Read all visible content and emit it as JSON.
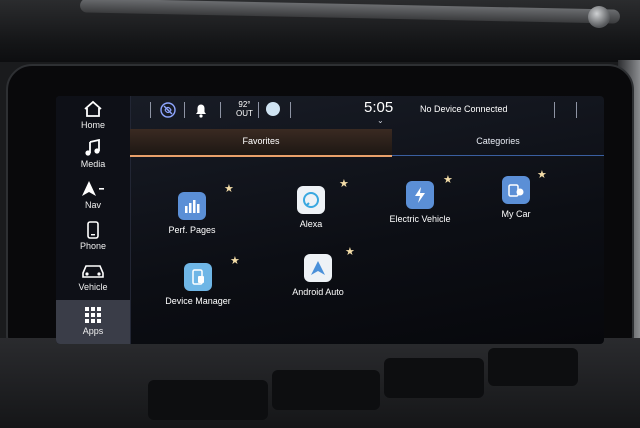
{
  "sidebar": {
    "items": [
      {
        "label": "Home",
        "icon": "home-icon"
      },
      {
        "label": "Media",
        "icon": "music-note-icon"
      },
      {
        "label": "Nav",
        "icon": "navigation-arrow-icon"
      },
      {
        "label": "Phone",
        "icon": "phone-icon"
      },
      {
        "label": "Vehicle",
        "icon": "car-icon"
      },
      {
        "label": "Apps",
        "icon": "apps-grid-icon",
        "active": true
      }
    ]
  },
  "status": {
    "temperature": "92°",
    "temperature_label": "OUT",
    "time": "5:05",
    "device_status": "No Device Connected"
  },
  "tabs": {
    "favorites": "Favorites",
    "categories": "Categories",
    "active": "Favorites"
  },
  "apps": [
    {
      "name": "Perf. Pages",
      "icon": "bar-chart-icon",
      "favorite": true
    },
    {
      "name": "Alexa",
      "icon": "alexa-icon",
      "favorite": true
    },
    {
      "name": "Electric Vehicle",
      "icon": "lightning-icon",
      "favorite": true
    },
    {
      "name": "My Car",
      "icon": "car-gauge-icon",
      "favorite": true
    },
    {
      "name": "Device Manager",
      "icon": "device-manager-icon",
      "favorite": true
    },
    {
      "name": "Android Auto",
      "icon": "android-auto-icon",
      "favorite": true
    }
  ],
  "colors": {
    "accent_orange": "#e8a06a",
    "accent_blue": "#3a5fa0",
    "tile_blue": "#5b8fd6",
    "star": "#f4dda8"
  }
}
